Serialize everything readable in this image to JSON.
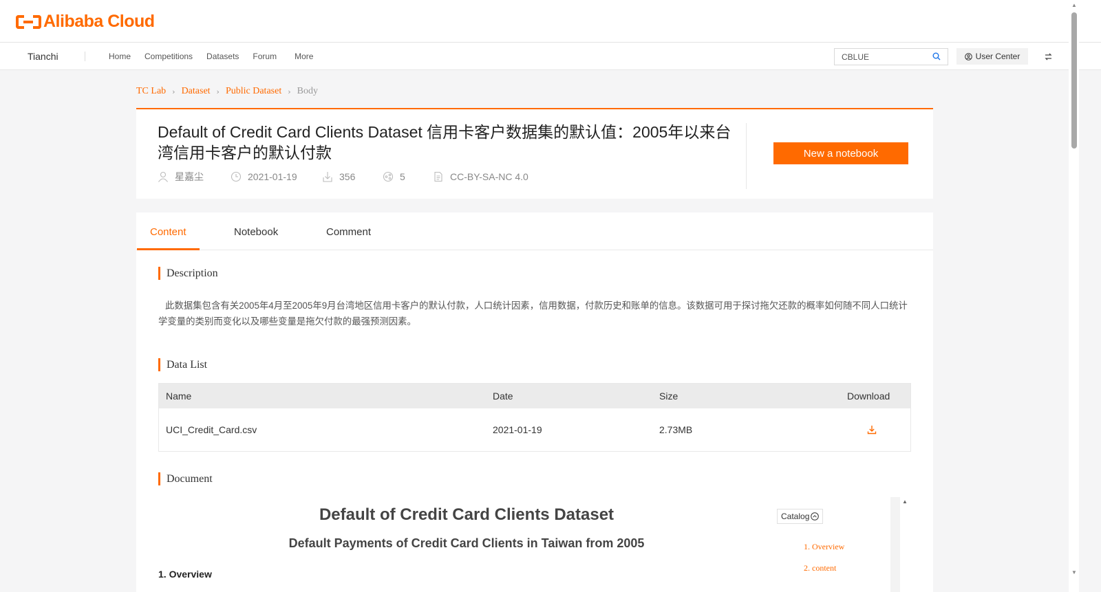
{
  "brand": {
    "logo_text": "Alibaba Cloud",
    "brand_color": "#ff6a00"
  },
  "nav": {
    "site_name": "Tianchi",
    "links": [
      "Home",
      "Competitions",
      "Datasets",
      "Forum",
      "More"
    ],
    "search_value": "CBLUE",
    "user_center": "User Center"
  },
  "breadcrumb": {
    "items": [
      "TC Lab",
      "Dataset",
      "Public Dataset"
    ],
    "current": "Body"
  },
  "dataset": {
    "title": "Default of Credit Card Clients Dataset 信用卡客户数据集的默认值：2005年以来台湾信用卡客户的默认付款",
    "author": "星嘉尘",
    "date": "2021-01-19",
    "downloads": "356",
    "shares": "5",
    "license": "CC-BY-SA-NC 4.0",
    "notebook_button": "New a notebook"
  },
  "tabs": [
    "Content",
    "Notebook",
    "Comment"
  ],
  "sections": {
    "description_title": "Description",
    "description_text": "此数据集包含有关2005年4月至2005年9月台湾地区信用卡客户的默认付款，人口统计因素，信用数据，付款历史和账单的信息。该数据可用于探讨拖欠还款的概率如何随不同人口统计学变量的类别而变化以及哪些变量是拖欠付款的最强预测因素。",
    "data_list_title": "Data List",
    "document_title": "Document"
  },
  "table": {
    "headers": [
      "Name",
      "Date",
      "Size",
      "Download"
    ],
    "rows": [
      {
        "name": "UCI_Credit_Card.csv",
        "date": "2021-01-19",
        "size": "2.73MB",
        "download_icon": "download-icon"
      }
    ]
  },
  "document": {
    "heading": "Default of Credit Card Clients Dataset",
    "subheading": "Default Payments of Credit Card Clients in Taiwan from 2005",
    "first_section": "1. Overview"
  },
  "catalog": {
    "label": "Catalog",
    "items": [
      "1. Overview",
      "2. content"
    ]
  }
}
